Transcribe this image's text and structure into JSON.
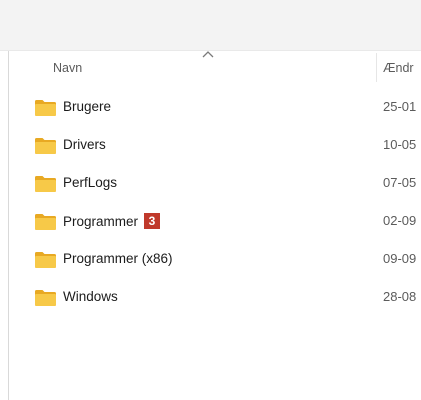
{
  "columns": {
    "name": "Navn",
    "modified": "Ændr"
  },
  "rows": [
    {
      "name": "Brugere",
      "date": "25-01",
      "icon": "folder-icon"
    },
    {
      "name": "Drivers",
      "date": "10-05",
      "icon": "folder-icon"
    },
    {
      "name": "PerfLogs",
      "date": "07-05",
      "icon": "folder-icon"
    },
    {
      "name": "Programmer",
      "date": "02-09",
      "icon": "folder-icon",
      "badge": "3"
    },
    {
      "name": "Programmer (x86)",
      "date": "09-09",
      "icon": "folder-icon"
    },
    {
      "name": "Windows",
      "date": "28-08",
      "icon": "folder-icon"
    }
  ],
  "colors": {
    "folder": "#f5c342",
    "badge": "#c0392b"
  }
}
